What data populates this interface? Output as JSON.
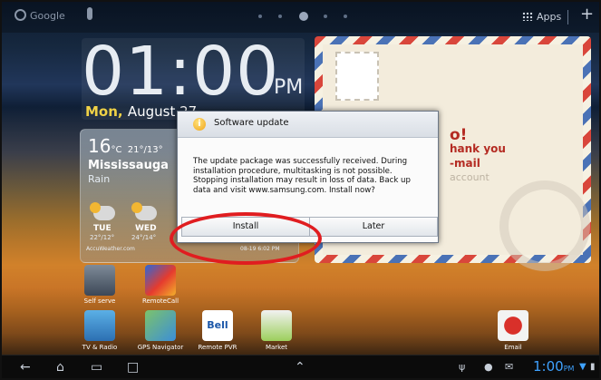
{
  "topbar": {
    "search_label": "Google",
    "apps_label": "Apps",
    "add_label": "+"
  },
  "clock": {
    "time": "01:00",
    "ampm": "PM",
    "day": "Mon,",
    "date": "August 27"
  },
  "weather": {
    "temp": "16",
    "temp_unit": "°C",
    "range": "21°/13°",
    "city": "Mississauga",
    "condition": "Rain",
    "forecast": [
      {
        "day": "TUE",
        "range": "22°/12°"
      },
      {
        "day": "WED",
        "range": "24°/14°"
      }
    ],
    "brand": "AccuWeather.com",
    "updated": "08-19 6:02 PM"
  },
  "postcard": {
    "line1": "o!",
    "line2": "hank you",
    "line3": "-mail",
    "line4": "account"
  },
  "dialog": {
    "title": "Software update",
    "message": "The update package was successfully received. During installation procedure, multitasking is not possible. Stopping installation may result in loss of data. Back up data and visit www.samsung.com. Install now?",
    "install_label": "Install",
    "later_label": "Later"
  },
  "shortcuts": {
    "row1": [
      {
        "label": "Self serve",
        "icon": "self-serve-icon"
      },
      {
        "label": "RemoteCall",
        "icon": "remotecall-icon"
      }
    ],
    "row2": [
      {
        "label": "TV & Radio",
        "icon": "tv-radio-icon"
      },
      {
        "label": "GPS Navigator",
        "icon": "gps-icon"
      },
      {
        "label": "Remote PVR",
        "icon": "bell-tv-icon",
        "text": "Bell"
      },
      {
        "label": "Market",
        "icon": "market-icon"
      },
      {
        "label": "Email",
        "icon": "email-icon"
      }
    ]
  },
  "status": {
    "time": "1:00",
    "ampm": "PM"
  }
}
